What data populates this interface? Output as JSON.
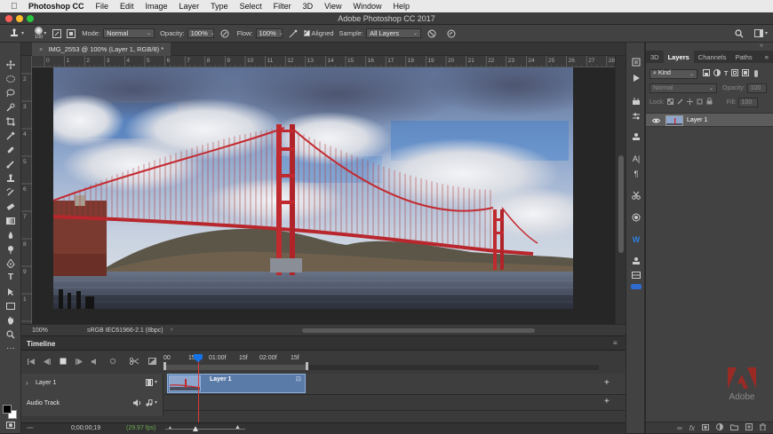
{
  "menubar": {
    "apple": "",
    "items": [
      "Photoshop CC",
      "File",
      "Edit",
      "Image",
      "Layer",
      "Type",
      "Select",
      "Filter",
      "3D",
      "View",
      "Window",
      "Help"
    ]
  },
  "window": {
    "title": "Adobe Photoshop CC 2017"
  },
  "options": {
    "brush_size": "100",
    "mode_label": "Mode:",
    "mode_value": "Normal",
    "opacity_label": "Opacity:",
    "opacity_value": "100%",
    "flow_label": "Flow:",
    "flow_value": "100%",
    "aligned_label": "Aligned",
    "sample_label": "Sample:",
    "sample_value": "All Layers"
  },
  "document": {
    "tab_label": "IMG_2553 @ 100% (Layer 1, RGB/8) *",
    "ruler_top": [
      "0",
      "1",
      "2",
      "3",
      "4",
      "5",
      "6",
      "7",
      "8",
      "9",
      "10",
      "11",
      "12",
      "13",
      "14",
      "15",
      "16",
      "17",
      "18",
      "19",
      "20",
      "21",
      "22",
      "23",
      "24",
      "25",
      "26",
      "27",
      "28"
    ],
    "ruler_left": [
      "2",
      "3",
      "4",
      "5",
      "6",
      "7",
      "8",
      "9",
      "1",
      "1"
    ],
    "zoom": "100%",
    "color_profile": "sRGB IEC61966-2.1 (8bpc)"
  },
  "timeline": {
    "title": "Timeline",
    "time_labels": [
      "00",
      "15f",
      "01:00f",
      "15f",
      "02:00f",
      "15f"
    ],
    "tracks": [
      {
        "name": "Layer 1",
        "clip_label": "Layer 1"
      },
      {
        "name": "Audio Track"
      }
    ],
    "current_time": "0;00;00;19",
    "fps": "(29.97 fps)"
  },
  "panels": {
    "tabs": [
      "3D",
      "Layers",
      "Channels",
      "Paths"
    ],
    "active_tab": "Layers",
    "filter_label": "Kind",
    "blend_mode": "Normal",
    "opacity_label": "Opacity:",
    "opacity_value": "100",
    "lock_label": "Lock:",
    "fill_label": "Fill:",
    "fill_value": "100",
    "layer_name": "Layer 1"
  },
  "brand": {
    "name": "Adobe"
  },
  "colors": {
    "accent": "#1473e6",
    "playhead": "#e23a3a",
    "clip": "#5a7ba8",
    "adobe_red": "#e0301e"
  }
}
